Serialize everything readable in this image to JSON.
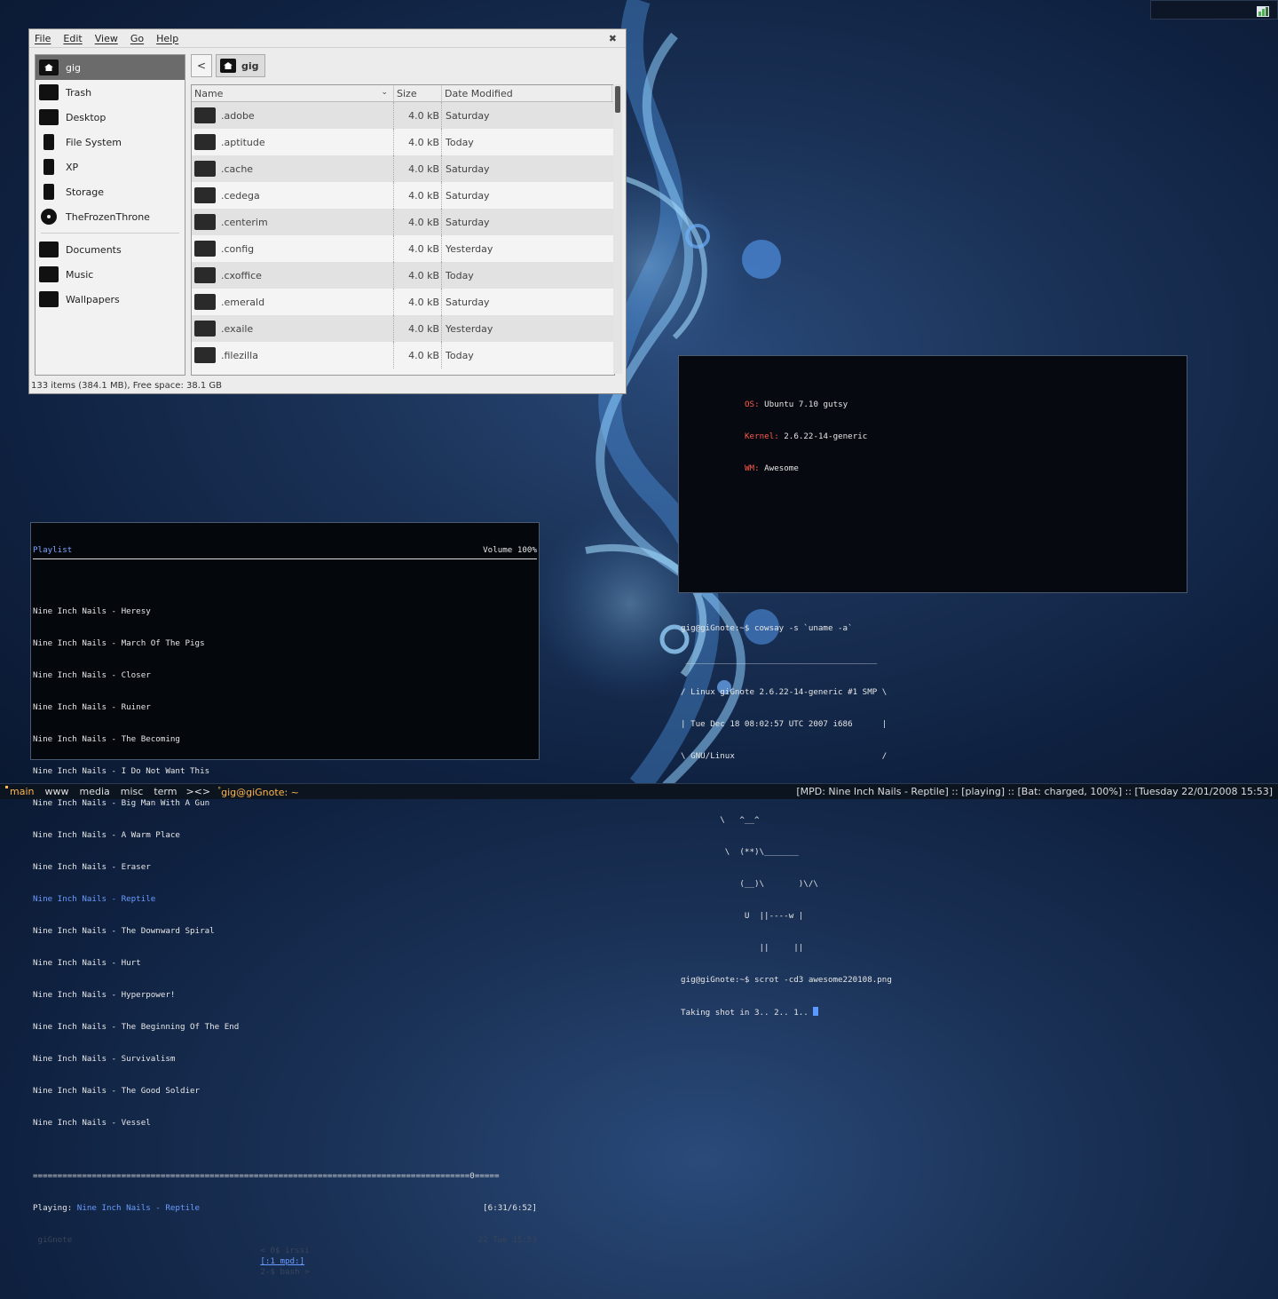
{
  "colors": {
    "accent": "#6a9bff",
    "tag_selected": "#ffb74a",
    "info_label": "#ff5a4a"
  },
  "file_manager": {
    "menu": [
      "File",
      "Edit",
      "View",
      "Go",
      "Help"
    ],
    "close_icon": "close-icon",
    "places": [
      {
        "label": "gig",
        "icon": "home-folder-icon",
        "selected": true
      },
      {
        "label": "Trash",
        "icon": "trash-icon"
      },
      {
        "label": "Desktop",
        "icon": "desktop-icon"
      },
      {
        "label": "File System",
        "icon": "drive-icon"
      },
      {
        "label": "XP",
        "icon": "drive-icon"
      },
      {
        "label": "Storage",
        "icon": "drive-icon"
      },
      {
        "label": "TheFrozenThrone",
        "icon": "cdrom-icon"
      },
      {
        "label": "Documents",
        "icon": "folder-icon"
      },
      {
        "label": "Music",
        "icon": "folder-icon"
      },
      {
        "label": "Wallpapers",
        "icon": "folder-icon"
      }
    ],
    "nav": {
      "back": "<",
      "crumb": "gig"
    },
    "columns": {
      "name": "Name",
      "size": "Size",
      "date": "Date Modified"
    },
    "rows": [
      {
        "name": ".adobe",
        "size": "4.0 kB",
        "date": "Saturday"
      },
      {
        "name": ".aptitude",
        "size": "4.0 kB",
        "date": "Today"
      },
      {
        "name": ".cache",
        "size": "4.0 kB",
        "date": "Saturday"
      },
      {
        "name": ".cedega",
        "size": "4.0 kB",
        "date": "Saturday"
      },
      {
        "name": ".centerim",
        "size": "4.0 kB",
        "date": "Saturday"
      },
      {
        "name": ".config",
        "size": "4.0 kB",
        "date": "Yesterday"
      },
      {
        "name": ".cxoffice",
        "size": "4.0 kB",
        "date": "Today"
      },
      {
        "name": ".emerald",
        "size": "4.0 kB",
        "date": "Saturday"
      },
      {
        "name": ".exaile",
        "size": "4.0 kB",
        "date": "Yesterday"
      },
      {
        "name": ".filezilla",
        "size": "4.0 kB",
        "date": "Today"
      }
    ],
    "status": "133 items (384.1 MB), Free space: 38.1 GB"
  },
  "terminal": {
    "info": [
      {
        "label": "OS:",
        "value": " Ubuntu 7.10 gutsy"
      },
      {
        "label": "Kernel:",
        "value": " 2.6.22-14-generic"
      },
      {
        "label": "WM:",
        "value": " Awesome"
      }
    ],
    "lines": [
      "gig@giGnote:~$ cowsay -s `uname -a`",
      " _______________________________________",
      "/ Linux giGnote 2.6.22-14-generic #1 SMP \\",
      "| Tue Dec 18 08:02:57 UTC 2007 i686      |",
      "\\ GNU/Linux                              /",
      " ---------------------------------------",
      "        \\   ^__^",
      "         \\  (**)\\_______",
      "            (__)\\       )\\/\\",
      "             U  ||----w |",
      "                ||     ||",
      "gig@giGnote:~$ scrot -cd3 awesome220108.png"
    ],
    "last_line": "Taking shot in 3.. 2.. 1.. "
  },
  "player": {
    "title": "Playlist",
    "volume": "Volume 100%",
    "tracks": [
      "Nine Inch Nails - Heresy",
      "Nine Inch Nails - March Of The Pigs",
      "Nine Inch Nails - Closer",
      "Nine Inch Nails - Ruiner",
      "Nine Inch Nails - The Becoming",
      "Nine Inch Nails - I Do Not Want This",
      "Nine Inch Nails - Big Man With A Gun",
      "Nine Inch Nails - A Warm Place",
      "Nine Inch Nails - Eraser",
      "Nine Inch Nails - Reptile",
      "Nine Inch Nails - The Downward Spiral",
      "Nine Inch Nails - Hurt",
      "Nine Inch Nails - Hyperpower!",
      "Nine Inch Nails - The Beginning Of The End",
      "Nine Inch Nails - Survivalism",
      "Nine Inch Nails - The Good Soldier",
      "Nine Inch Nails - Vessel"
    ],
    "current_index": 9,
    "progress_bar": "=========================================================================================0=====",
    "playing_label": "Playing: ",
    "playing_track": "Nine Inch Nails - Reptile",
    "time": "[6:31/6:52]",
    "screen_host": " giGnote",
    "screen_windows": [
      "< 0$ irssi",
      "[:1 mpd:]",
      "2-$ bash >"
    ],
    "screen_clock": "22 Tue 15:53"
  },
  "taskbar": {
    "tags": [
      "main",
      "www",
      "media",
      "misc",
      "term"
    ],
    "layout": "><>",
    "task_title": "gig@giGnote: ~",
    "status": "[MPD: Nine Inch Nails - Reptile] :: [playing] :: [Bat: charged, 100%] :: [Tuesday 22/01/2008 15:53]"
  }
}
